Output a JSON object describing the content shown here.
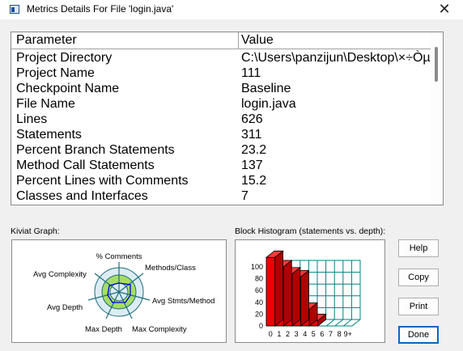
{
  "window": {
    "title": "Metrics Details For File 'login.java'",
    "close_glyph": "✕",
    "app_icon": "window-icon"
  },
  "table": {
    "headers": {
      "parameter": "Parameter",
      "value": "Value"
    },
    "rows": [
      {
        "param": "Project Directory",
        "value": "C:\\Users\\panzijun\\Desktop\\×÷ÒµĈ"
      },
      {
        "param": "Project Name",
        "value": "111"
      },
      {
        "param": "Checkpoint Name",
        "value": "Baseline"
      },
      {
        "param": "File Name",
        "value": "login.java"
      },
      {
        "param": "Lines",
        "value": "626"
      },
      {
        "param": "Statements",
        "value": "311"
      },
      {
        "param": "Percent Branch Statements",
        "value": "23.2"
      },
      {
        "param": "Method Call Statements",
        "value": "137"
      },
      {
        "param": "Percent Lines with Comments",
        "value": "15.2"
      },
      {
        "param": "Classes and Interfaces",
        "value": "7"
      }
    ]
  },
  "kiviat": {
    "label": "Kiviat Graph:",
    "axes": {
      "comments": "% Comments",
      "methods_class": "Methods/Class",
      "avg_stmts_method": "Avg Stmts/Method",
      "max_complexity": "Max Complexity",
      "max_depth": "Max Depth",
      "avg_depth": "Avg Depth",
      "avg_complexity": "Avg Complexity"
    }
  },
  "histogram": {
    "label": "Block Histogram (statements vs. depth):",
    "y_ticks": [
      "100",
      "80",
      "60",
      "40",
      "20",
      "0"
    ],
    "x_ticks": [
      "0",
      "1",
      "2",
      "3",
      "4",
      "5",
      "6",
      "7",
      "8",
      "9+"
    ],
    "bar_color": "#ee0000",
    "grid_color": "#008080"
  },
  "chart_data": {
    "type": "bar",
    "categories": [
      "0",
      "1",
      "2",
      "3",
      "4",
      "5",
      "6",
      "7",
      "8",
      "9+"
    ],
    "values": [
      116,
      100,
      88,
      83,
      28,
      9,
      0,
      0,
      0,
      0
    ],
    "xlabel": "",
    "ylabel": "",
    "ylim": [
      0,
      100
    ]
  },
  "buttons": {
    "help": "Help",
    "copy": "Copy",
    "print": "Print",
    "done": "Done"
  }
}
